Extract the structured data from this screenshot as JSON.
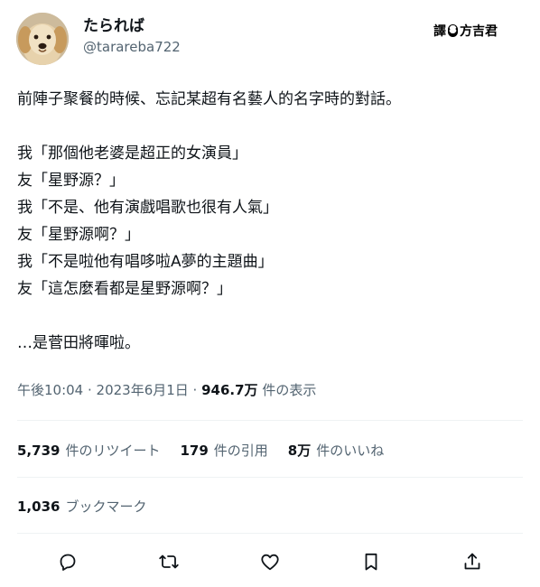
{
  "author": {
    "display_name": "たられば",
    "handle": "@tarareba722",
    "avatar_icon": "golden-retriever-avatar"
  },
  "watermark": {
    "prefix": "譯",
    "dot": "8",
    "name": "方吉君"
  },
  "tweet": {
    "lines": [
      "前陣子聚餐的時候、忘記某超有名藝人的名字時的對話。",
      "",
      "我「那個他老婆是超正的女演員」",
      "友「星野源？」",
      "我「不是、他有演戲唱歌也很有人氣」",
      "友「星野源啊？」",
      "我「不是啦他有唱哆啦A夢的主題曲」",
      "友「這怎麼看都是星野源啊？」",
      "",
      "…是菅田將暉啦。"
    ]
  },
  "meta": {
    "time_date": "午後10:04 · 2023年6月1日 · ",
    "views_count": "946.7万",
    "views_label": " 件の表示"
  },
  "stats": {
    "retweets_count": "5,739",
    "retweets_label": "件のリツイート",
    "quotes_count": "179",
    "quotes_label": "件の引用",
    "likes_count": "8万",
    "likes_label": "件のいいね",
    "bookmarks_count": "1,036",
    "bookmarks_label": "ブックマーク"
  },
  "colors": {
    "text": "#0f1419",
    "secondary": "#536471",
    "divider": "#eff3f4"
  },
  "actions": [
    "reply-icon",
    "retweet-icon",
    "like-icon",
    "bookmark-icon",
    "share-icon"
  ]
}
